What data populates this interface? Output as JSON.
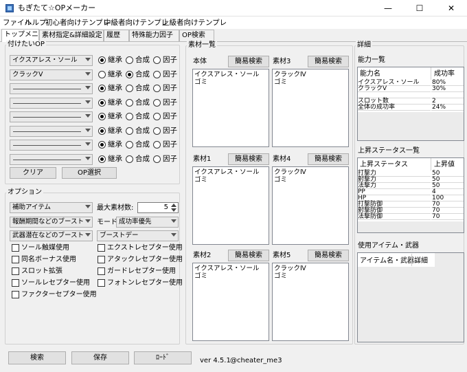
{
  "window": {
    "title": "もぎたて☆OPメーカー",
    "minimize": "—",
    "maximize": "☐",
    "close": "✕"
  },
  "menu": [
    "ファイル",
    "ヘルプ",
    "初心者向けテンプレ",
    "中級者向けテンプレ",
    "上級者向けテンプレ"
  ],
  "tabs": [
    "トップメニュー",
    "素材指定&詳細設定",
    "履歴",
    "特殊能力因子",
    "OP検索"
  ],
  "desired_op": {
    "legend": "付けたいOP",
    "rows": [
      {
        "combo": "イクスアレス・ソール",
        "selected": "継承"
      },
      {
        "combo": "クラックⅤ",
        "selected": "合成"
      },
      {
        "combo": "",
        "selected": "継承"
      },
      {
        "combo": "",
        "selected": "継承"
      },
      {
        "combo": "",
        "selected": "継承"
      },
      {
        "combo": "",
        "selected": "継承"
      },
      {
        "combo": "",
        "selected": "継承"
      },
      {
        "combo": "",
        "selected": "継承"
      }
    ],
    "radio_labels": [
      "継承",
      "合成",
      "因子"
    ],
    "clear_button": "クリア",
    "op_select_button": "OP選択"
  },
  "options": {
    "legend": "オプション",
    "combo1": "補助アイテム",
    "combo2": "報酬期間などのブースト",
    "combo3": "武器潜在などのブースト",
    "max_material_label": "最大素材数:",
    "max_material_value": "5",
    "mode_label": "モード:",
    "mode_value": "成功率優先",
    "boost_day": "ブーストデー",
    "checkboxes_left": [
      "ソール触媒使用",
      "同名ボーナス使用",
      "スロット拡張",
      "ソールレセプター使用",
      "ファクターセプター使用"
    ],
    "checkboxes_right": [
      "エクストレセプター使用",
      "アタックレセプター使用",
      "ガードレセプター使用",
      "フォトンレセプター使用"
    ]
  },
  "materials": {
    "legend": "素材一覧",
    "quick_search": "簡易検索",
    "boxes": [
      {
        "name": "本体",
        "items": [
          "イクスアレス・ソール",
          "ゴミ"
        ]
      },
      {
        "name": "素材3",
        "items": [
          "クラックⅣ",
          "ゴミ"
        ]
      },
      {
        "name": "素材1",
        "items": [
          "イクスアレス・ソール",
          "ゴミ"
        ]
      },
      {
        "name": "素材4",
        "items": [
          "クラックⅣ",
          "ゴミ"
        ]
      },
      {
        "name": "素材2",
        "items": [
          "イクスアレス・ソール",
          "ゴミ"
        ]
      },
      {
        "name": "素材5",
        "items": [
          "クラックⅣ",
          "ゴミ"
        ]
      }
    ]
  },
  "details": {
    "legend": "詳細",
    "ability_title": "能力一覧",
    "ability_headers": [
      "能力名",
      "成功率"
    ],
    "ability_rows": [
      [
        "イクスアレス・ソール",
        "80%"
      ],
      [
        "クラックⅤ",
        "30%"
      ],
      [
        "",
        ""
      ],
      [
        "スロット数",
        "2"
      ],
      [
        "全体の成功率",
        "24%"
      ]
    ],
    "status_title": "上昇ステータス一覧",
    "status_headers": [
      "上昇ステータス",
      "上昇値"
    ],
    "status_rows": [
      [
        "打撃力",
        "50"
      ],
      [
        "射撃力",
        "50"
      ],
      [
        "法撃力",
        "50"
      ],
      [
        "PP",
        "4"
      ],
      [
        "HP",
        "100"
      ],
      [
        "打撃防御",
        "70"
      ],
      [
        "射撃防御",
        "70"
      ],
      [
        "法撃防御",
        "70"
      ]
    ],
    "items_title": "使用アイテム・武器",
    "items_headers": [
      "アイテム名・武器...",
      "詳細"
    ]
  },
  "footer": {
    "search": "検索",
    "save": "保存",
    "load": "ﾛｰﾄﾞ",
    "version": "ver 4.5.1",
    "author": "@cheater_me3"
  }
}
